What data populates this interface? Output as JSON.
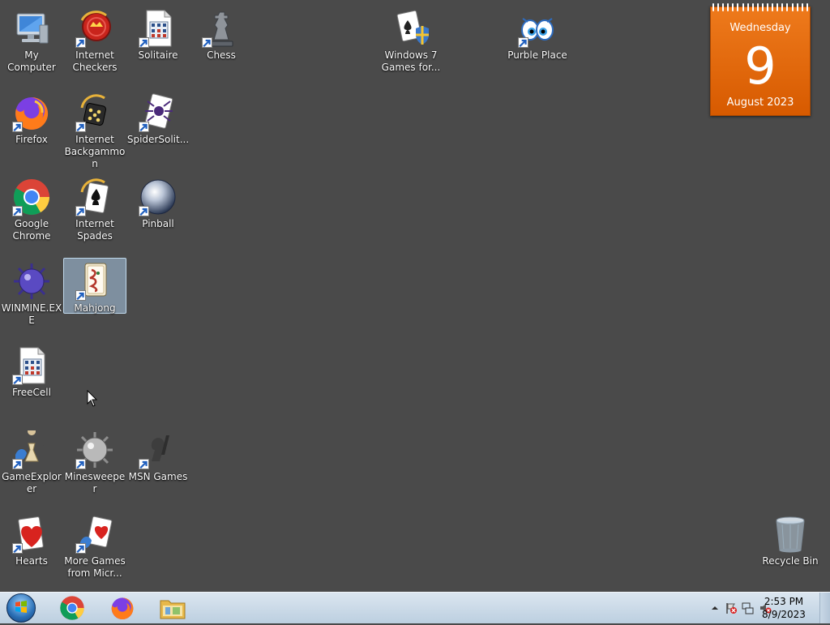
{
  "desktop": {
    "icons": [
      {
        "label": "My Computer",
        "icon": "computer-icon"
      },
      {
        "label": "Internet Checkers",
        "icon": "checkers-icon"
      },
      {
        "label": "Solitaire",
        "icon": "solitaire-icon"
      },
      {
        "label": "Chess",
        "icon": "chess-icon"
      },
      {
        "label": "Windows 7 Games for...",
        "icon": "windows7-games-icon"
      },
      {
        "label": "Purble Place",
        "icon": "purble-place-icon"
      },
      {
        "label": "Firefox",
        "icon": "firefox-icon"
      },
      {
        "label": "Internet Backgammon",
        "icon": "backgammon-icon"
      },
      {
        "label": "SpiderSolit...",
        "icon": "spider-solitaire-icon"
      },
      {
        "label": "Google Chrome",
        "icon": "chrome-icon"
      },
      {
        "label": "Internet Spades",
        "icon": "spades-icon"
      },
      {
        "label": "Pinball",
        "icon": "pinball-icon"
      },
      {
        "label": "WINMINE.EXE",
        "icon": "mine-icon"
      },
      {
        "label": "Mahjong",
        "icon": "mahjong-icon"
      },
      {
        "label": "FreeCell",
        "icon": "freecell-icon"
      },
      {
        "label": "GameExplorer",
        "icon": "game-explorer-icon"
      },
      {
        "label": "Minesweeper",
        "icon": "minesweeper-icon"
      },
      {
        "label": "MSN Games",
        "icon": "msn-games-icon"
      },
      {
        "label": "Hearts",
        "icon": "hearts-icon"
      },
      {
        "label": "More Games from Micr...",
        "icon": "more-games-icon"
      },
      {
        "label": "Recycle Bin",
        "icon": "recycle-bin-icon"
      }
    ],
    "selected": "Mahjong"
  },
  "calendar": {
    "weekday": "Wednesday",
    "day": "9",
    "month_year": "August 2023",
    "color": "#e06a0c"
  },
  "taskbar": {
    "start": "start-orb-icon",
    "pinned": [
      "chrome-icon",
      "firefox-icon",
      "file-explorer-icon"
    ],
    "tray_icons": [
      "show-hidden-icons-icon",
      "action-center-flag-icon",
      "network-icon",
      "volume-muted-icon"
    ],
    "clock": {
      "time": "2:53 PM",
      "date": "8/9/2023"
    }
  },
  "colors": {
    "desktop": "#4a4a4a",
    "taskbar": "#c8d8e8"
  }
}
